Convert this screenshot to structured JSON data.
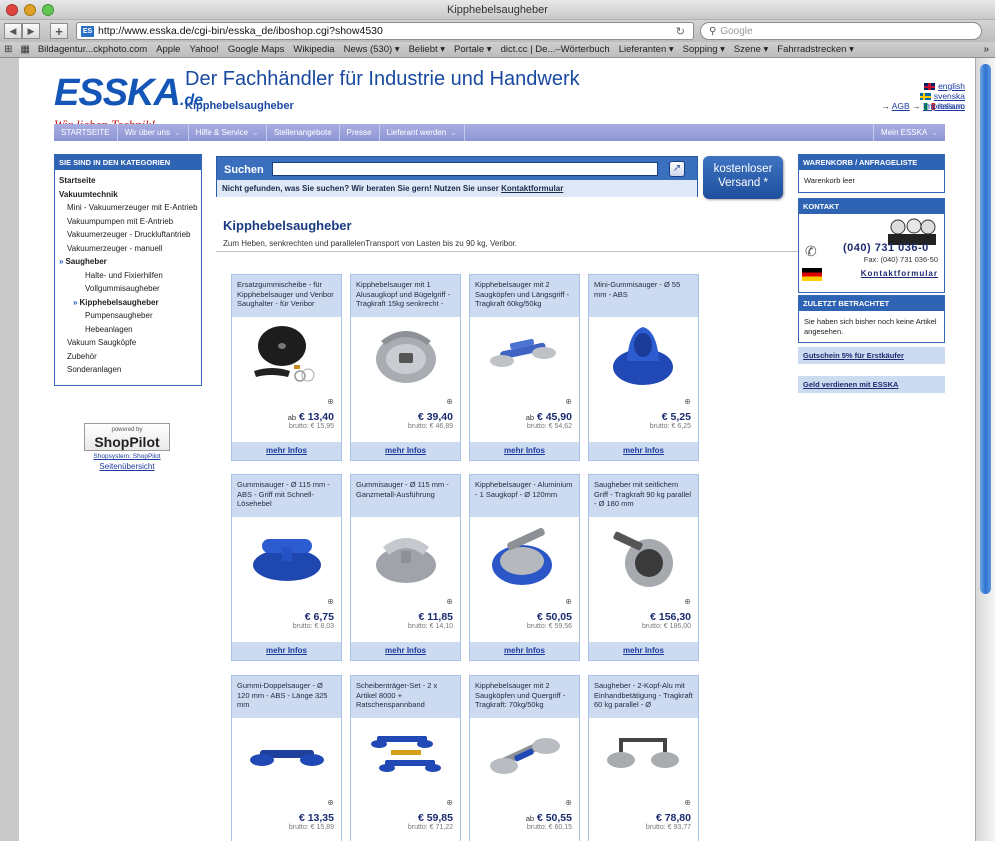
{
  "browser": {
    "window_title": "Kipphebelsaugheber",
    "url": "http://www.esska.de/cgi-bin/esska_de/iboshop.cgi?show4530",
    "search_placeholder": "Google",
    "bookmarks": [
      "Bildagentur...ckphoto.com",
      "Apple",
      "Yahoo!",
      "Google Maps",
      "Wikipedia",
      "News (530) ▾",
      "Beliebt ▾",
      "Portale ▾",
      "dict.cc | De...–Wörterbuch",
      "Lieferanten ▾",
      "Sopping ▾",
      "Szene ▾",
      "Fahrradstrecken ▾"
    ]
  },
  "header": {
    "logo_main": "ESSKA",
    "logo_tld": ".de",
    "logo_tagline": "Wir lieben Technik!",
    "headline": "Der Fachhändler für Industrie und Handwerk",
    "subhead": "Kipphebelsaugheber",
    "languages": [
      "english",
      "svenska",
      "italiano"
    ],
    "agb": "AGB",
    "impressum": "Impressum"
  },
  "nav": {
    "items": [
      "STARTSEITE",
      "Wir über uns",
      "Hilfe & Service",
      "Stellenangebote",
      "Presse",
      "Lieferant werden"
    ],
    "account": "Mein ESSKA"
  },
  "sidebar": {
    "title": "SIE SIND IN DEN KATEGORIEN",
    "items": [
      "Startseite",
      "Vakuumtechnik",
      "Mini - Vakuumerzeuger mit E-Antrieb",
      "Vakuumpumpen mit E-Antrieb",
      "Vakuumerzeuger - Druckluftantrieb",
      "Vakuumerzeuger - manuell",
      "Saugheber",
      "Halte- und Fixierhilfen",
      "Vollgummisaugheber",
      "Kipphebelsaugheber",
      "Pumpensaugheber",
      "Hebeanlagen",
      "Vakuum Saugköpfe",
      "Zubehör",
      "Sonderanlagen"
    ],
    "powered_by": "powered by",
    "powered_brand": "ShopPilot",
    "shopsystem": "Shopsystem: ShopPilot",
    "sitemap": "Seitenübersicht"
  },
  "search": {
    "label": "Suchen",
    "hint": "Nicht gefunden, was Sie suchen? Wir beraten Sie gern! Nutzen Sie unser",
    "hint_link": "Kontaktformular"
  },
  "shipping_badge": {
    "line1": "kostenloser",
    "line2": "Versand *"
  },
  "category": {
    "title": "Kipphebelsaugheber",
    "description": "Zum Heben, senkrechten und parallelenTransport von Lasten bis zu 90 kg, Veribor."
  },
  "products": [
    {
      "name": "Ersatzgummischeibe - für Kipphebelsauger und Veribor Saughalter - für Veribor",
      "price_prefix": "ab",
      "price": "€ 13,40",
      "gross": "brutto: € 15,95",
      "more": "mehr Infos"
    },
    {
      "name": "Kipphebelsauger mit 1 Alusaugkopf und Bügelgriff - Tragkraft 15kg senkrecht -",
      "price_prefix": "",
      "price": "€ 39,40",
      "gross": "brutto: € 46,89",
      "more": "mehr Infos"
    },
    {
      "name": "Kipphebelsauger mit 2 Saugköpfen und Längsgriff - Tragkraft 60kg/50kg",
      "price_prefix": "ab",
      "price": "€ 45,90",
      "gross": "brutto: € 54,62",
      "more": "mehr Infos"
    },
    {
      "name": "Mini-Gummisauger - Ø 55 mm - ABS",
      "price_prefix": "",
      "price": "€ 5,25",
      "gross": "brutto: € 6,25",
      "more": "mehr Infos"
    },
    {
      "name": "Gummisauger - Ø 115 mm - ABS - Griff mit Schnell-Lösehebel",
      "price_prefix": "",
      "price": "€ 6,75",
      "gross": "brutto: € 8,03",
      "more": "mehr Infos"
    },
    {
      "name": "Gummisauger - Ø 115 mm - Ganzmetall-Ausführung",
      "price_prefix": "",
      "price": "€ 11,85",
      "gross": "brutto: € 14,10",
      "more": "mehr Infos"
    },
    {
      "name": "Kipphebelsauger - Aluminium - 1 Saugkopf - Ø 120mm",
      "price_prefix": "",
      "price": "€ 50,05",
      "gross": "brutto: € 59,56",
      "more": "mehr Infos"
    },
    {
      "name": "Saugheber mit seitlichem Griff - Tragkraft 90 kg parallel - Ø 180 mm",
      "price_prefix": "",
      "price": "€ 156,30",
      "gross": "brutto: € 186,00",
      "more": "mehr Infos"
    },
    {
      "name": "Gummi-Doppelsauger - Ø 120 mm - ABS - Länge 325 mm",
      "price_prefix": "",
      "price": "€ 13,35",
      "gross": "brutto: € 15,89",
      "more": ""
    },
    {
      "name": "Scheibenträger-Set - 2 x Artikel 8000 + Ratschenspannband",
      "price_prefix": "",
      "price": "€ 59,85",
      "gross": "brutto: € 71,22",
      "more": ""
    },
    {
      "name": "Kipphebelsauger mit 2 Saugköpfen und Quergriff - Tragkraft: 70kg/50kg",
      "price_prefix": "ab",
      "price": "€ 50,55",
      "gross": "brutto: € 60,15",
      "more": ""
    },
    {
      "name": "Saugheber - 2-Kopf-Alu mit Einhandbetätigung - Tragkraft 60 kg parallel - Ø",
      "price_prefix": "",
      "price": "€ 78,80",
      "gross": "brutto: € 93,77",
      "more": ""
    }
  ],
  "right": {
    "cart_title": "WARENKORB / ANFRAGELISTE",
    "cart_body": "Warenkorb leer",
    "contact_title": "KONTAKT",
    "phone": "(040) 731 036-0",
    "fax": "Fax: (040) 731 036-50",
    "contact_form": "Kontaktformular",
    "recent_title": "ZULETZT BETRACHTET",
    "recent_body": "Sie haben sich bisher noch keine Artikel angesehen.",
    "voucher": "Gutschein 5% für Erstkäufer",
    "earn": "Geld verdienen mit ESSKA"
  },
  "colors": {
    "brand_blue": "#2f63b3",
    "nav_purple": "#9aa0dc",
    "card_tint": "#cddbf0",
    "logo_red": "#c4191b"
  }
}
